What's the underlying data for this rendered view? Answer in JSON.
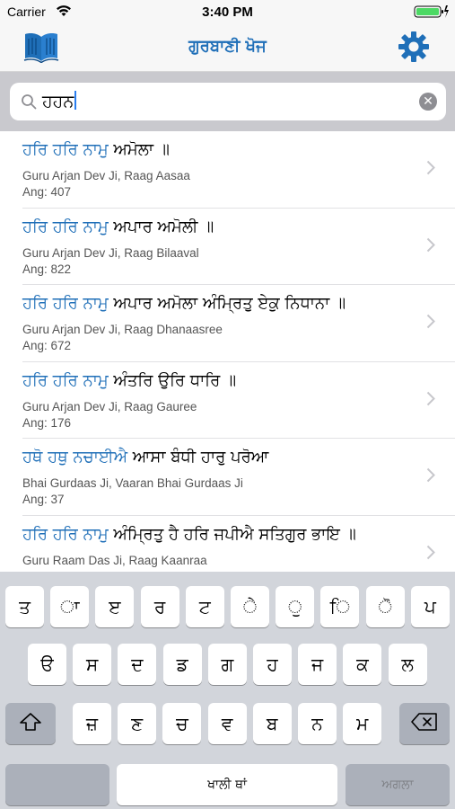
{
  "status_bar": {
    "carrier": "Carrier",
    "time": "3:40 PM"
  },
  "nav": {
    "title": "ਗੁਰਬਾਣੀ ਖੋਜ",
    "left_icon": "book-icon",
    "right_icon": "gear-icon"
  },
  "search": {
    "value": "ਹਹਨ"
  },
  "results": [
    {
      "highlight": "ਹਰਿ ਹਰਿ ਨਾਮੁ",
      "rest": " ਅਮੋਲਾ ॥",
      "author": "Guru Arjan Dev Ji, Raag Aasaa",
      "ang": "Ang: 407"
    },
    {
      "highlight": "ਹਰਿ ਹਰਿ ਨਾਮੁ",
      "rest": " ਅਪਾਰ ਅਮੋਲੀ ॥",
      "author": "Guru Arjan Dev Ji, Raag Bilaaval",
      "ang": "Ang: 822"
    },
    {
      "highlight": "ਹਰਿ ਹਰਿ ਨਾਮੁ",
      "rest": " ਅਪਾਰ ਅਮੋਲਾ ਅੰਮ੍ਰਿਤੁ ਏਕੁ ਨਿਧਾਨਾ ॥",
      "author": "Guru Arjan Dev Ji, Raag Dhanaasree",
      "ang": "Ang: 672"
    },
    {
      "highlight": "ਹਰਿ ਹਰਿ ਨਾਮੁ",
      "rest": " ਅੰਤਰਿ ਉਰਿ ਧਾਰਿ ॥",
      "author": "Guru Arjan Dev Ji, Raag Gauree",
      "ang": "Ang: 176"
    },
    {
      "highlight": "ਹਥੋ ਹਥੁ ਨਚਾਈਐ",
      "rest": " ਆਸਾ ਬੰਧੀ ਹਾਰੁ ਪਰੋਆ",
      "author": "Bhai Gurdaas Ji, Vaaran Bhai Gurdaas Ji",
      "ang": "Ang: 37"
    },
    {
      "highlight": "ਹਰਿ ਹਰਿ ਨਾਮੁ",
      "rest": " ਅੰਮ੍ਰਿਤੁ ਹੈ ਹਰਿ ਜਪੀਐ ਸਤਿਗੁਰ ਭਾਇ ॥",
      "author": "Guru Raam Das Ji, Raag Kaanraa",
      "ang": ""
    }
  ],
  "keyboard": {
    "row1": [
      "ਤ",
      "ਾ",
      "ੲ",
      "ਰ",
      "ਟ",
      "ੇ",
      "ੁ",
      "ਿ",
      "ੋ",
      "ਪ"
    ],
    "row2": [
      "ੳ",
      "ਸ",
      "ਦ",
      "ਡ",
      "ਗ",
      "ਹ",
      "ਜ",
      "ਕ",
      "ਲ"
    ],
    "row3": [
      "ਜ਼",
      "ਣ",
      "ਚ",
      "ਵ",
      "ਬ",
      "ਨ",
      "ਮ"
    ],
    "space_label": "ਖਾਲੀ ਥਾਂ",
    "next_label": "ਅਗਲਾ"
  },
  "colors": {
    "accent": "#1f6fb8",
    "keyboard_bg": "#d2d5db"
  }
}
